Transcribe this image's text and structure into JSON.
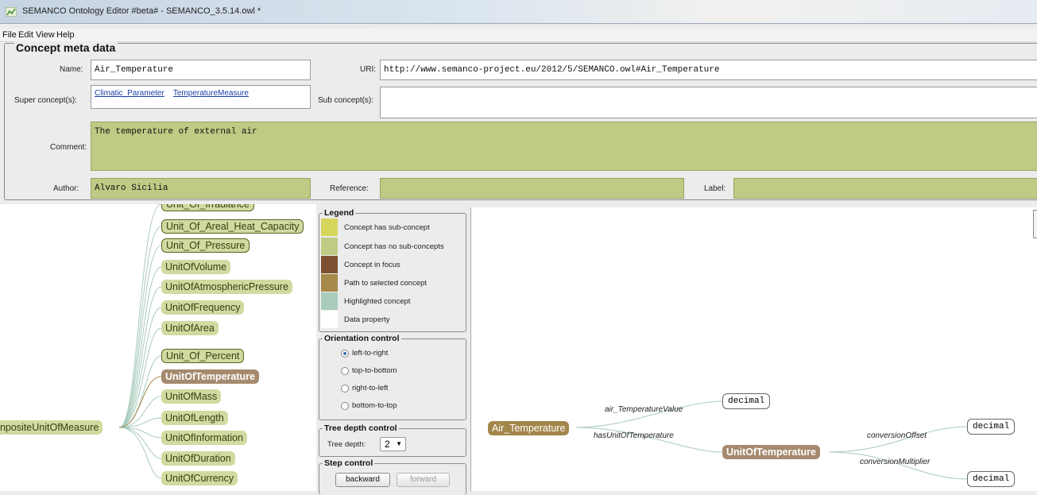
{
  "window": {
    "title": "SEMANCO Ontology Editor  #beta# - SEMANCO_3.5.14.owl *"
  },
  "menu": [
    "File",
    "Edit",
    "View",
    "Help"
  ],
  "meta": {
    "section_title": "Concept meta data",
    "name_label": "Name:",
    "name_value": "Air_Temperature",
    "uri_label": "URI:",
    "uri_value": "http://www.semanco-project.eu/2012/5/SEMANCO.owl#Air_Temperature",
    "super_label": "Super concept(s):",
    "super_links": [
      "Climatic_Parameter",
      "TemperatureMeasure"
    ],
    "sub_label": "Sub concept(s):",
    "comment_label": "Comment:",
    "comment_value": "The temperature of external air",
    "author_label": "Author:",
    "author_value": "Alvaro Sicilia",
    "reference_label": "Reference:",
    "reference_value": "",
    "label_label": "Label:",
    "label_value": ""
  },
  "tree": {
    "root": "pnpositeUnitOfMeasure",
    "children": [
      "Unit_Of_Irradiance",
      "Unit_Of_Areal_Heat_Capacity",
      "Unit_Of_Pressure",
      "UnitOfVolume",
      "UnitOfAtmosphericPressure",
      "UnitOfFrequency",
      "UnitOfArea",
      "Unit_Of_Percent",
      "UnitOfTemperature",
      "UnitOfMass",
      "UnitOfLength",
      "UnitOfInformation",
      "UnitOfDuration",
      "UnitOfCurrency"
    ]
  },
  "legend": {
    "title": "Legend",
    "items": [
      {
        "color": "#d7d65c",
        "label": "Concept has sub-concept"
      },
      {
        "color": "#bdcb84",
        "label": "Concept has no sub-concepts"
      },
      {
        "color": "#7c5030",
        "label": "Concept in focus"
      },
      {
        "color": "#a6884a",
        "label": "Path to selected concept"
      },
      {
        "color": "#a9cbbb",
        "label": "Highlighted concept"
      },
      {
        "color": "#ffffff",
        "label": "Data property"
      }
    ]
  },
  "orientation": {
    "title": "Orientation control",
    "options": [
      "left-to-right",
      "top-to-bottom",
      "right-to-left",
      "bottom-to-top"
    ],
    "selected": "left-to-right"
  },
  "depth": {
    "title": "Tree depth control",
    "label": "Tree depth:",
    "value": "2"
  },
  "step": {
    "title": "Step control",
    "backward": "backward",
    "forward": "forward"
  },
  "graph": {
    "focus": "Air_Temperature",
    "unit": "UnitOfTemperature",
    "decimal": "decimal",
    "edges": {
      "value": "air_TemperatureValue",
      "unit": "hasUnitOfTemperature",
      "offset": "conversionOffset",
      "multiplier": "conversionMultiplier"
    }
  }
}
